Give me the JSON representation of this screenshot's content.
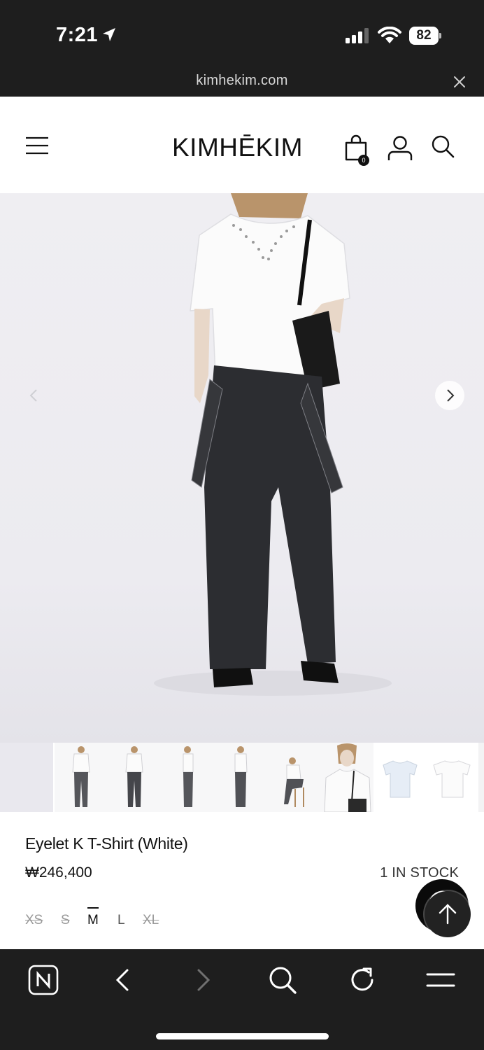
{
  "status_bar": {
    "time": "7:21",
    "battery": "82"
  },
  "browser": {
    "url": "kimhekim.com"
  },
  "header": {
    "logo": "KIMHĒKIM",
    "bag_count": "0"
  },
  "product": {
    "name": "Eyelet K T-Shirt (White)",
    "price": "₩246,400",
    "stock": "1 IN STOCK",
    "sizes": [
      {
        "label": "XS",
        "state": "unavailable"
      },
      {
        "label": "S",
        "state": "unavailable"
      },
      {
        "label": "M",
        "state": "selected"
      },
      {
        "label": "L",
        "state": "available"
      },
      {
        "label": "XL",
        "state": "unavailable"
      }
    ]
  },
  "toolbar": {
    "items": [
      "naver-icon",
      "back-arrow-icon",
      "forward-arrow-icon",
      "search-icon",
      "reload-icon",
      "menu-icon"
    ]
  }
}
